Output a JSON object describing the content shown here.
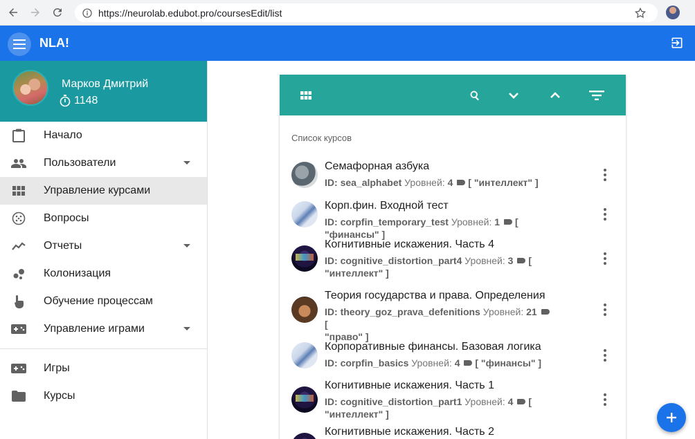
{
  "browser": {
    "url": "https://neurolab.edubot.pro/coursesEdit/list"
  },
  "app": {
    "title": "NLA!",
    "accent": "#1a73e8",
    "profile_bg": "#1a9aa0",
    "toolbar_bg": "#26a69a"
  },
  "user": {
    "name": "Марков Дмитрий",
    "coins": "1148"
  },
  "sidebar": {
    "menu": [
      {
        "label": "Начало",
        "icon": "clipboard-icon",
        "expandable": false
      },
      {
        "label": "Пользователи",
        "icon": "people-icon",
        "expandable": true
      },
      {
        "label": "Управление курсами",
        "icon": "grid-icon",
        "expandable": false,
        "active": true
      },
      {
        "label": "Вопросы",
        "icon": "dotted-circle-icon",
        "expandable": false
      },
      {
        "label": "Отчеты",
        "icon": "trending-icon",
        "expandable": true
      },
      {
        "label": "Колонизация",
        "icon": "bubbles-icon",
        "expandable": false
      },
      {
        "label": "Обучение процессам",
        "icon": "touch-icon",
        "expandable": false
      },
      {
        "label": "Управление играми",
        "icon": "gamepad-icon",
        "expandable": true
      }
    ],
    "bottom": [
      {
        "label": "Игры",
        "icon": "gamepad-icon"
      },
      {
        "label": "Курсы",
        "icon": "folder-icon"
      }
    ]
  },
  "courses": {
    "section_title": "Список курсов",
    "id_prefix": "ID:",
    "levels_prefix": "Уровней:",
    "items": [
      {
        "title": "Семафорная азбука",
        "id": "sea_alphabet",
        "levels": "4",
        "tags": "[ \"интеллект\" ]"
      },
      {
        "title": "Корп.фин. Входной тест",
        "id": "corpfin_temporary_test",
        "levels": "1",
        "tags": "[ \"финансы\" ]"
      },
      {
        "title": "Когнитивные искажения. Часть 4",
        "id": "cognitive_distortion_part4",
        "levels": "3",
        "tags_a": "[",
        "tags_b": "\"интеллект\" ]"
      },
      {
        "title": "Теория государства и права. Определения",
        "id": "theory_goz_prava_defenitions",
        "levels": "21",
        "tags_a": "[",
        "tags_b": "\"право\" ]"
      },
      {
        "title": "Корпоративные финансы. Базовая логика",
        "id": "corpfin_basics",
        "levels": "4",
        "tags": "[ \"финансы\" ]"
      },
      {
        "title": "Когнитивные искажения. Часть 1",
        "id": "cognitive_distortion_part1",
        "levels": "4",
        "tags_a": "[",
        "tags_b": "\"интеллект\" ]"
      },
      {
        "title": "Когнитивные искажения. Часть 2"
      }
    ]
  }
}
